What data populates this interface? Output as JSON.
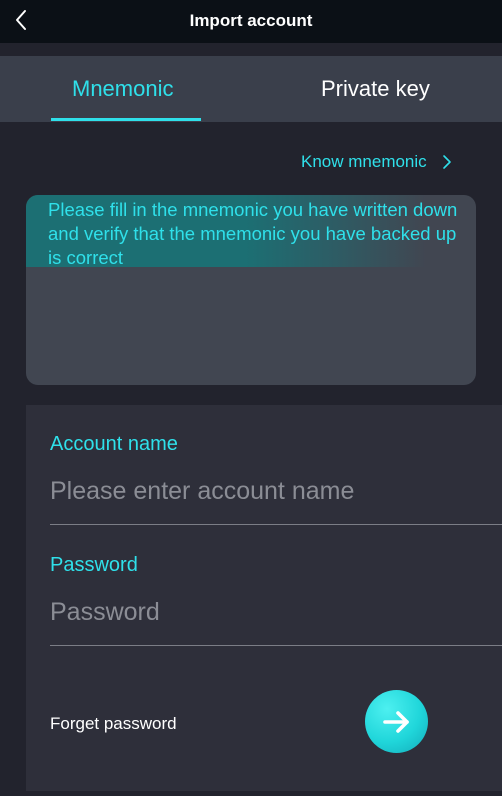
{
  "header": {
    "title": "Import account",
    "back_icon": "chevron-left-icon"
  },
  "tabs": [
    {
      "label": "Mnemonic",
      "active": true
    },
    {
      "label": "Private key",
      "active": false
    }
  ],
  "know_link": {
    "label": "Know mnemonic",
    "icon": "chevron-right-icon"
  },
  "mnemonic": {
    "hint": "Please fill in the mnemonic you have written down and verify that the mnemonic you have backed up is correct",
    "value": ""
  },
  "form": {
    "account_name_label": "Account name",
    "account_name_placeholder": "Please enter account name",
    "password_label": "Password",
    "password_placeholder": "Password",
    "forget_password": "Forget password",
    "submit_icon": "arrow-right-icon"
  },
  "colors": {
    "accent": "#2fe0ea",
    "background": "#22232d",
    "header": "#0b1016",
    "tabbar": "#3a3f4b",
    "card": "#2e2f3a"
  }
}
